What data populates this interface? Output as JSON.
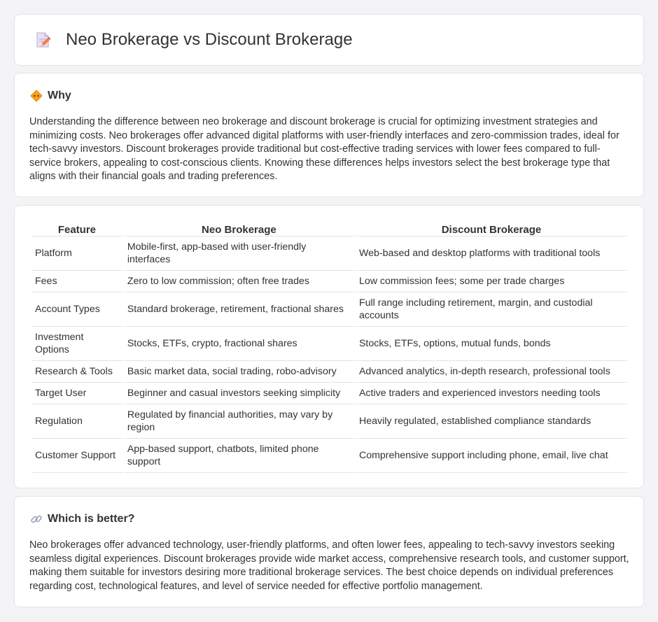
{
  "header": {
    "title": "Neo Brokerage vs Discount Brokerage",
    "icon": "document-edit-icon"
  },
  "why": {
    "icon": "diamond-sign-icon",
    "title": "Why",
    "body": "Understanding the difference between neo brokerage and discount brokerage is crucial for optimizing investment strategies and minimizing costs. Neo brokerages offer advanced digital platforms with user-friendly interfaces and zero-commission trades, ideal for tech-savvy investors. Discount brokerages provide traditional but cost-effective trading services with lower fees compared to full-service brokers, appealing to cost-conscious clients. Knowing these differences helps investors select the best brokerage type that aligns with their financial goals and trading preferences."
  },
  "comparison": {
    "headers": [
      "Feature",
      "Neo Brokerage",
      "Discount Brokerage"
    ],
    "rows": [
      {
        "feature": "Platform",
        "neo": "Mobile-first, app-based with user-friendly interfaces",
        "discount": "Web-based and desktop platforms with traditional tools"
      },
      {
        "feature": "Fees",
        "neo": "Zero to low commission; often free trades",
        "discount": "Low commission fees; some per trade charges"
      },
      {
        "feature": "Account Types",
        "neo": "Standard brokerage, retirement, fractional shares",
        "discount": "Full range including retirement, margin, and custodial accounts"
      },
      {
        "feature": "Investment Options",
        "neo": "Stocks, ETFs, crypto, fractional shares",
        "discount": "Stocks, ETFs, options, mutual funds, bonds"
      },
      {
        "feature": "Research & Tools",
        "neo": "Basic market data, social trading, robo-advisory",
        "discount": "Advanced analytics, in-depth research, professional tools"
      },
      {
        "feature": "Target User",
        "neo": "Beginner and casual investors seeking simplicity",
        "discount": "Active traders and experienced investors needing tools"
      },
      {
        "feature": "Regulation",
        "neo": "Regulated by financial authorities, may vary by region",
        "discount": "Heavily regulated, established compliance standards"
      },
      {
        "feature": "Customer Support",
        "neo": "App-based support, chatbots, limited phone support",
        "discount": "Comprehensive support including phone, email, live chat"
      }
    ]
  },
  "better": {
    "icon": "link-icon",
    "title": "Which is better?",
    "body": "Neo brokerages offer advanced technology, user-friendly platforms, and often lower fees, appealing to tech-savvy investors seeking seamless digital experiences. Discount brokerages provide wide market access, comprehensive research tools, and customer support, making them suitable for investors desiring more traditional brokerage services. The best choice depends on individual preferences regarding cost, technological features, and level of service needed for effective portfolio management."
  },
  "colors": {
    "background": "#f4f4f6",
    "card": "#ffffff",
    "border": "#e4e4e8",
    "text": "#333333",
    "accent_orange": "#f5a623"
  }
}
